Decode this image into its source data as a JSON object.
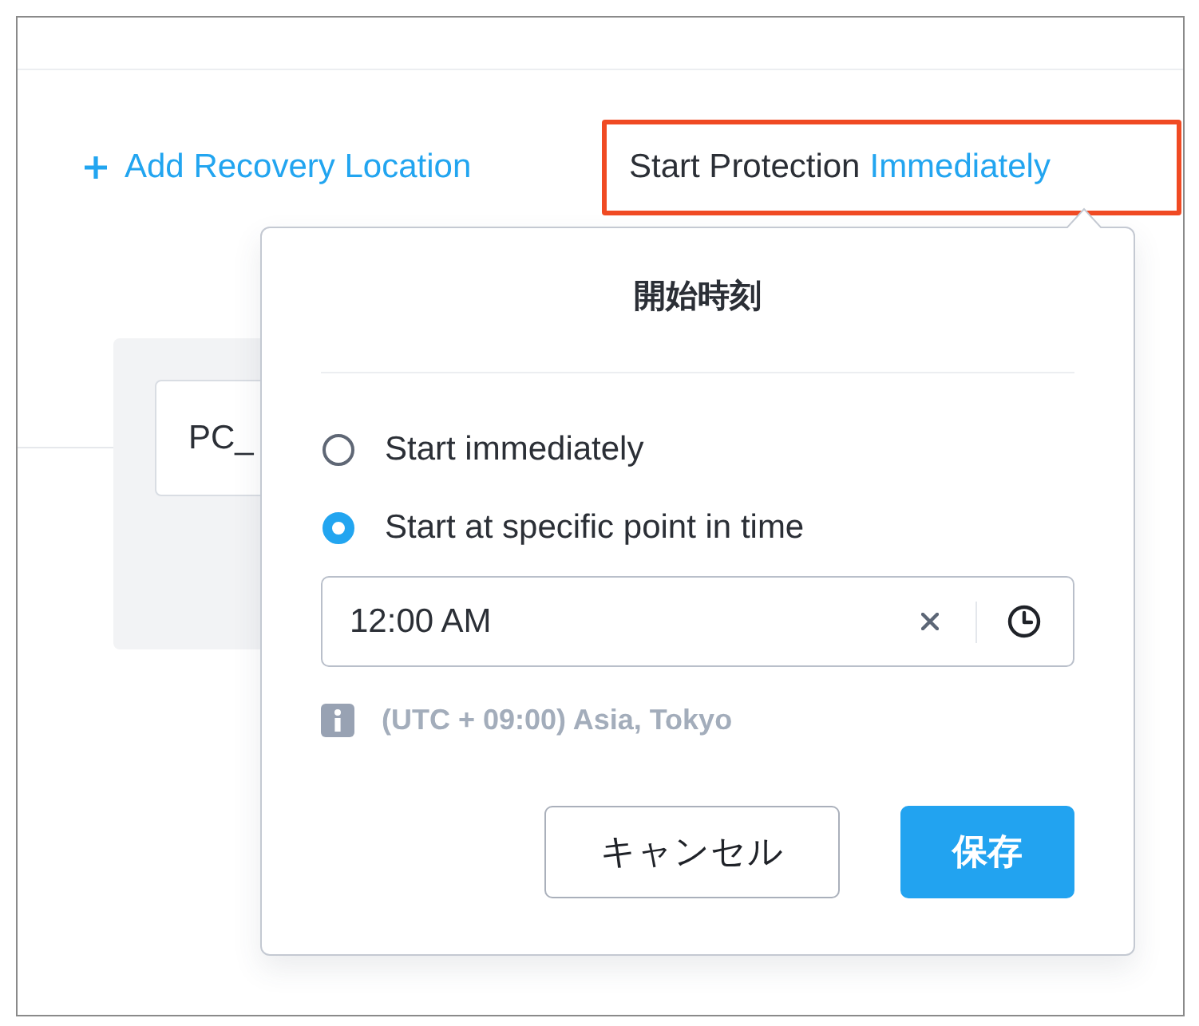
{
  "add_location_link": {
    "label": "Add Recovery Location"
  },
  "start_protection": {
    "label": "Start Protection",
    "value": "Immediately",
    "highlighted": true
  },
  "background_field": {
    "value": "PC_"
  },
  "popover": {
    "title": "開始時刻",
    "options": [
      {
        "label": "Start immediately",
        "selected": false
      },
      {
        "label": "Start at specific point in time",
        "selected": true
      }
    ],
    "time_field": {
      "value": "12:00 AM"
    },
    "timezone_note": "(UTC + 09:00) Asia, Tokyo",
    "buttons": [
      {
        "label": "キャンセル",
        "kind": "secondary"
      },
      {
        "label": "保存",
        "kind": "primary"
      }
    ]
  }
}
